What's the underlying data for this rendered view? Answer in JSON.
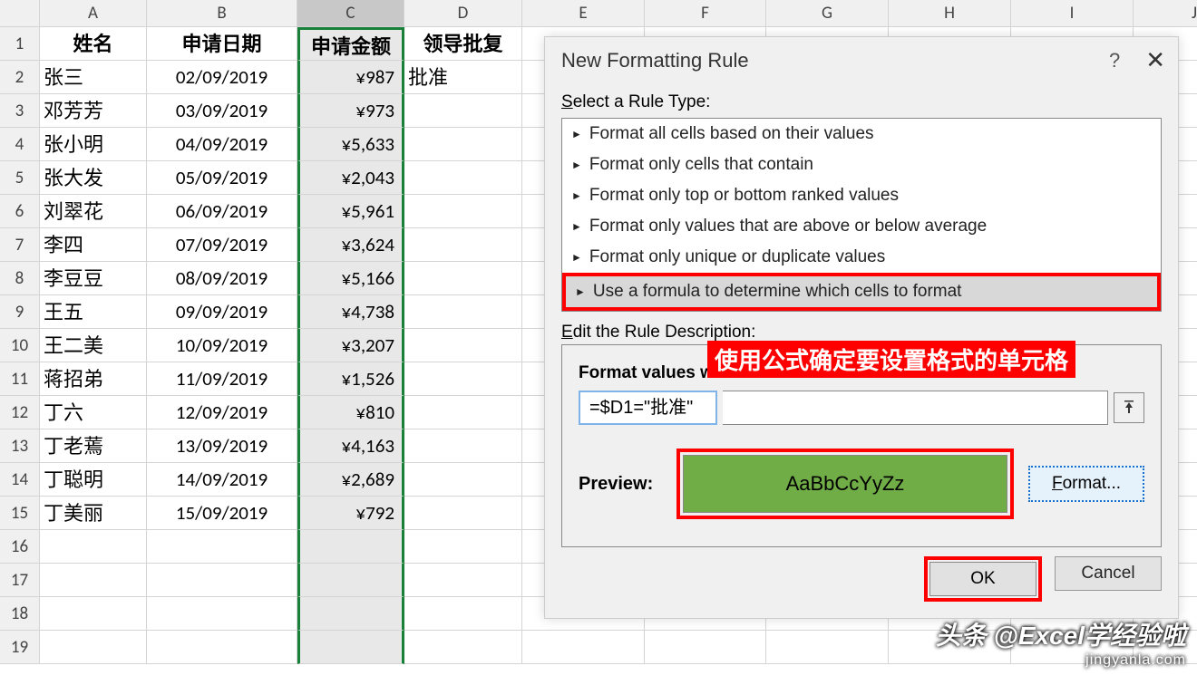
{
  "columns": [
    "A",
    "B",
    "C",
    "D",
    "E",
    "F",
    "G",
    "H",
    "I",
    "J"
  ],
  "headers": {
    "A": "姓名",
    "B": "申请日期",
    "C": "申请金额",
    "D": "领导批复"
  },
  "rows": [
    {
      "n": "2",
      "a": "张三",
      "b": "02/09/2019",
      "c": "¥987",
      "d": "批准"
    },
    {
      "n": "3",
      "a": "邓芳芳",
      "b": "03/09/2019",
      "c": "¥973",
      "d": ""
    },
    {
      "n": "4",
      "a": "张小明",
      "b": "04/09/2019",
      "c": "¥5,633",
      "d": ""
    },
    {
      "n": "5",
      "a": "张大发",
      "b": "05/09/2019",
      "c": "¥2,043",
      "d": ""
    },
    {
      "n": "6",
      "a": "刘翠花",
      "b": "06/09/2019",
      "c": "¥5,961",
      "d": ""
    },
    {
      "n": "7",
      "a": "李四",
      "b": "07/09/2019",
      "c": "¥3,624",
      "d": ""
    },
    {
      "n": "8",
      "a": "李豆豆",
      "b": "08/09/2019",
      "c": "¥5,166",
      "d": ""
    },
    {
      "n": "9",
      "a": "王五",
      "b": "09/09/2019",
      "c": "¥4,738",
      "d": ""
    },
    {
      "n": "10",
      "a": "王二美",
      "b": "10/09/2019",
      "c": "¥3,207",
      "d": ""
    },
    {
      "n": "11",
      "a": "蒋招弟",
      "b": "11/09/2019",
      "c": "¥1,526",
      "d": ""
    },
    {
      "n": "12",
      "a": "丁六",
      "b": "12/09/2019",
      "c": "¥810",
      "d": ""
    },
    {
      "n": "13",
      "a": "丁老蔫",
      "b": "13/09/2019",
      "c": "¥4,163",
      "d": ""
    },
    {
      "n": "14",
      "a": "丁聪明",
      "b": "14/09/2019",
      "c": "¥2,689",
      "d": ""
    },
    {
      "n": "15",
      "a": "丁美丽",
      "b": "15/09/2019",
      "c": "¥792",
      "d": ""
    }
  ],
  "empty_rows": [
    "16",
    "17",
    "18",
    "19"
  ],
  "dialog": {
    "title": "New Formatting Rule",
    "help": "?",
    "select_label_u": "S",
    "select_label_rest": "elect a Rule Type:",
    "rules": [
      "Format all cells based on their values",
      "Format only cells that contain",
      "Format only top or bottom ranked values",
      "Format only values that are above or below average",
      "Format only unique or duplicate values",
      "Use a formula to determine which cells to format"
    ],
    "edit_label_u": "E",
    "edit_label_rest": "dit the Rule Description:",
    "formula_caption": "Format values where this formula is true:",
    "formula_value": "=$D1=\"批准\"",
    "preview_label": "Preview:",
    "preview_text": "AaBbCcYyZz",
    "format_btn_u": "F",
    "format_btn_rest": "ormat...",
    "ok": "OK",
    "cancel": "Cancel"
  },
  "annotation": "使用公式确定要设置格式的单元格",
  "watermark": {
    "line1": "头条 @Excel学经验啦",
    "line2": "jingyanla.com"
  }
}
